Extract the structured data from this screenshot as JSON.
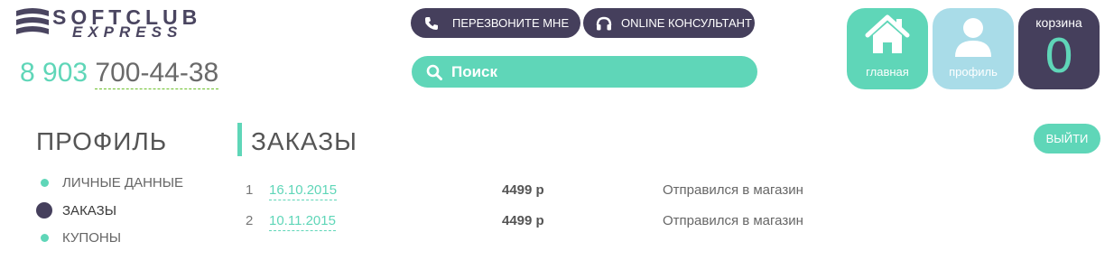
{
  "header": {
    "logo_line1": "SOFTCLUB",
    "logo_line2": "EXPRESS",
    "phone_code": "8 903",
    "phone_number": "700-44-38",
    "callback_label": "ПЕРЕЗВОНИТЕ МНЕ",
    "consultant_label": "ONLINE КОНСУЛЬТАНТ",
    "search_placeholder": "Поиск",
    "home_label": "главная",
    "profile_label": "профиль",
    "cart_label": "корзина",
    "cart_count": "0"
  },
  "sidebar": {
    "title": "ПРОФИЛЬ",
    "items": [
      {
        "label": "ЛИЧНЫЕ ДАННЫЕ"
      },
      {
        "label": "ЗАКАЗЫ"
      },
      {
        "label": "КУПОНЫ"
      }
    ]
  },
  "main": {
    "title": "ЗАКАЗЫ",
    "logout_label": "ВЫЙТИ",
    "orders": [
      {
        "num": "1",
        "date": "16.10.2015",
        "price": "4499 р",
        "status": "Отправился в магазин"
      },
      {
        "num": "2",
        "date": "10.11.2015",
        "price": "4499 р",
        "status": "Отправился в магазин"
      }
    ]
  },
  "colors": {
    "accent": "#5fd6b8",
    "dark": "#453f5c",
    "light_blue": "#a9dce8"
  }
}
